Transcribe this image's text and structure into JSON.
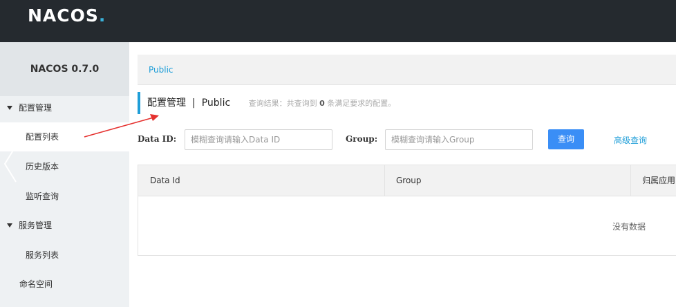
{
  "header": {
    "logo_text": "NACOS",
    "logo_dot": "."
  },
  "sidebar": {
    "title": "NACOS 0.7.0",
    "items": [
      {
        "label": "配置管理"
      },
      {
        "label": "配置列表"
      },
      {
        "label": "历史版本"
      },
      {
        "label": "监听查询"
      },
      {
        "label": "服务管理"
      },
      {
        "label": "服务列表"
      },
      {
        "label": "命名空间"
      }
    ]
  },
  "breadcrumb": {
    "namespace": "Public"
  },
  "page": {
    "title": "配置管理",
    "separator": "|",
    "namespace": "Public",
    "result_prefix": "查询结果：共查询到",
    "result_count": "0",
    "result_suffix": "条满足要求的配置。"
  },
  "search": {
    "data_id_label": "Data ID:",
    "data_id_placeholder": "模糊查询请输入Data ID",
    "group_label": "Group:",
    "group_placeholder": "模糊查询请输入Group",
    "query_button": "查询",
    "advanced_link": "高级查询"
  },
  "table": {
    "columns": [
      "Data Id",
      "Group",
      "归属应用"
    ],
    "empty_text": "没有数据"
  },
  "colors": {
    "accent": "#1f9ed8",
    "primary_button": "#3a8ef6",
    "topbar": "#252a2f",
    "annotation_arrow": "#e5312f"
  }
}
